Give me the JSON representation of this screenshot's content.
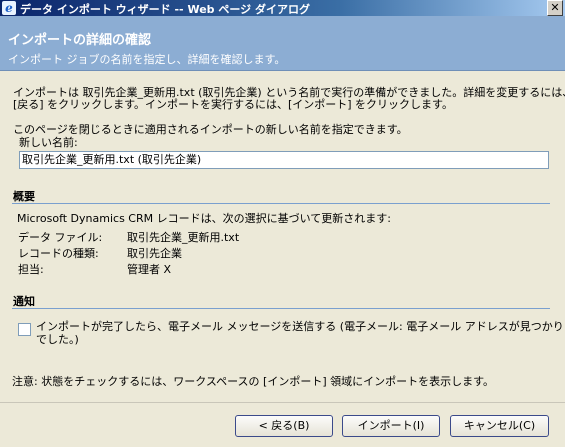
{
  "window": {
    "title": "データ インポート ウィザード -- Web ページ ダイアログ",
    "close_glyph": "✕"
  },
  "banner": {
    "heading": "インポートの詳細の確認",
    "subtitle": "インポート ジョブの名前を指定し、詳細を確認します。"
  },
  "intro": {
    "line1": "インポートは 取引先企業_更新用.txt (取引先企業) という名前で実行の準備ができました。詳細を変更するには、",
    "line2": "[戻る] をクリックします。インポートを実行するには、[インポート] をクリックします。"
  },
  "name_prompt": "このページを閉じるときに適用されるインポートの新しい名前を指定できます。",
  "name_field": {
    "label": "新しい名前:",
    "value": "取引先企業_更新用.txt (取引先企業)"
  },
  "summary": {
    "title": "概要",
    "description": "Microsoft Dynamics CRM レコードは、次の選択に基づいて更新されます:",
    "rows": [
      {
        "label": "データ ファイル:",
        "value": "取引先企業_更新用.txt"
      },
      {
        "label": "レコードの種類:",
        "value": "取引先企業"
      },
      {
        "label": "担当:",
        "value": "管理者 X"
      }
    ]
  },
  "notification": {
    "title": "通知",
    "checkbox_line1": "インポートが完了したら、電子メール メッセージを送信する (電子メール: 電子メール アドレスが見つかりませ",
    "checkbox_line2": "でした。)",
    "checked": false
  },
  "note": "注意: 状態をチェックするには、ワークスペースの [インポート] 領域にインポートを表示します。",
  "buttons": {
    "back": "< 戻る(B)",
    "import": "インポート(I)",
    "cancel": "キャンセル(C)"
  }
}
